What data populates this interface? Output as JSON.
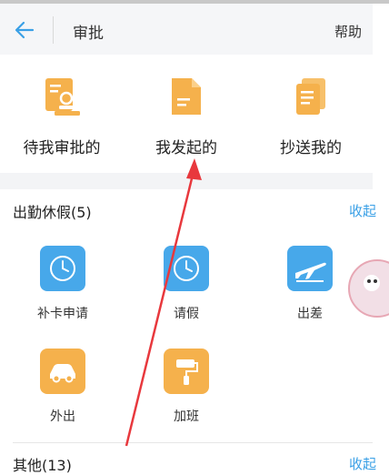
{
  "header": {
    "title": "审批",
    "help": "帮助"
  },
  "quick_actions": [
    {
      "label": "待我审批的"
    },
    {
      "label": "我发起的"
    },
    {
      "label": "抄送我的"
    }
  ],
  "sections": [
    {
      "title": "出勤休假(5)",
      "toggle": "收起",
      "items": [
        {
          "label": "补卡申请"
        },
        {
          "label": "请假"
        },
        {
          "label": "出差"
        },
        {
          "label": "外出"
        },
        {
          "label": "加班"
        }
      ]
    },
    {
      "title": "其他(13)",
      "toggle": "收起"
    }
  ],
  "colors": {
    "accent_blue": "#3aa0e6",
    "tile_blue": "#47a8ea",
    "tile_orange": "#f5b14c",
    "arrow_red": "#e8383d"
  }
}
